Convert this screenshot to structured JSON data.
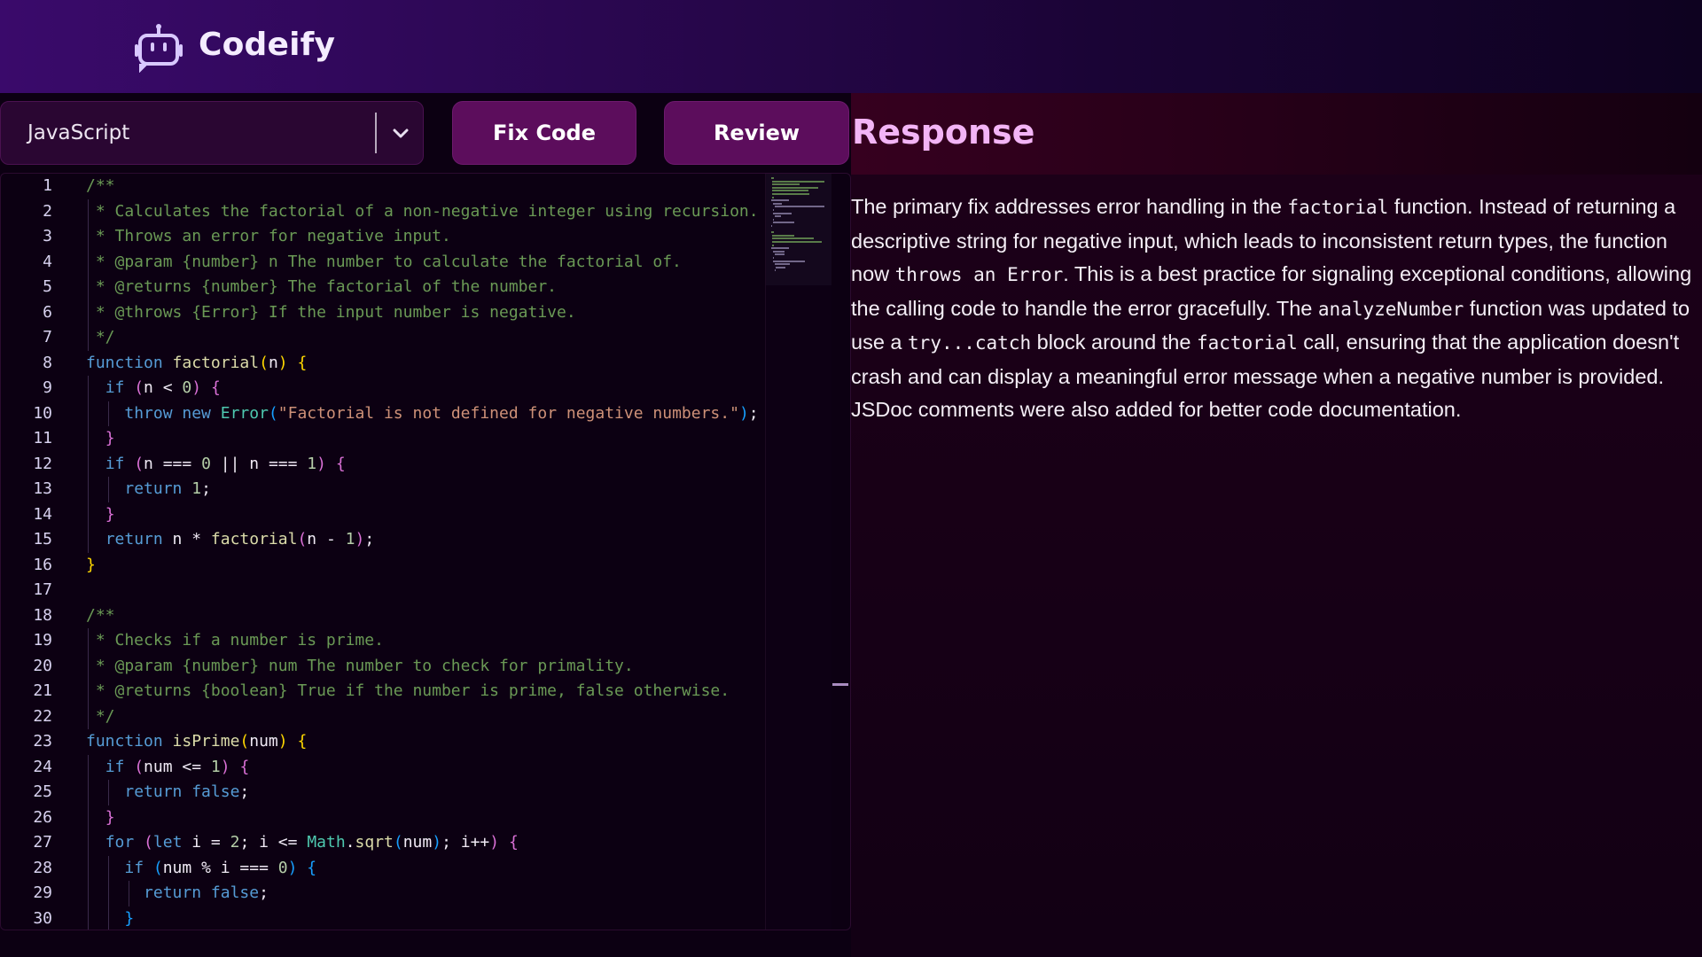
{
  "app": {
    "name": "Codeify",
    "logo_icon": "robot-icon"
  },
  "toolbar": {
    "language_value": "JavaScript",
    "fix_label": "Fix Code",
    "review_label": "Review"
  },
  "response": {
    "title": "Response",
    "seg": [
      "The primary fix addresses error handling in the ",
      "factorial",
      " function. Instead of returning a descriptive string for negative input, which leads to inconsistent return types, the function now ",
      "throws an Error",
      ". This is a best practice for signaling exceptional conditions, allowing the calling code to handle the error gracefully. The ",
      "analyzeNumber",
      " function was updated to use a ",
      "try...catch",
      " block around the ",
      "factorial",
      " call, ensuring that the application doesn't crash and can display a meaningful error message when a negative number is provided. JSDoc comments were also added for better code documentation."
    ]
  },
  "editor": {
    "line_numbers": [
      "1",
      "2",
      "3",
      "4",
      "5",
      "6",
      "7",
      "8",
      "9",
      "10",
      "11",
      "12",
      "13",
      "14",
      "15",
      "16",
      "17",
      "18",
      "19",
      "20",
      "21",
      "22",
      "23",
      "24",
      "25",
      "26",
      "27",
      "28",
      "29",
      "30"
    ],
    "lines": [
      [
        [
          "cm",
          "/**"
        ]
      ],
      [
        [
          "cm",
          " * Calculates the factorial of a non-negative integer using recursion."
        ]
      ],
      [
        [
          "cm",
          " * Throws an error for negative input."
        ]
      ],
      [
        [
          "cm",
          " * @param {number} n The number to calculate the factorial of."
        ]
      ],
      [
        [
          "cm",
          " * @returns {number} The factorial of the number."
        ]
      ],
      [
        [
          "cm",
          " * @throws {Error} If the input number is negative."
        ]
      ],
      [
        [
          "cm",
          " */"
        ]
      ],
      [
        [
          "kw",
          "function "
        ],
        [
          "fn",
          "factorial"
        ],
        [
          "p1",
          "("
        ],
        [
          "pl",
          "n"
        ],
        [
          "p1",
          ")"
        ],
        [
          "pl",
          " "
        ],
        [
          "p1",
          "{"
        ]
      ],
      [
        [
          "pl",
          "  "
        ],
        [
          "kw",
          "if "
        ],
        [
          "p2",
          "("
        ],
        [
          "pl",
          "n < "
        ],
        [
          "num",
          "0"
        ],
        [
          "p2",
          ")"
        ],
        [
          "pl",
          " "
        ],
        [
          "p2",
          "{"
        ]
      ],
      [
        [
          "pl",
          "    "
        ],
        [
          "kw",
          "throw new "
        ],
        [
          "cls",
          "Error"
        ],
        [
          "p3",
          "("
        ],
        [
          "str",
          "\"Factorial is not defined for negative numbers.\""
        ],
        [
          "p3",
          ")"
        ],
        [
          "pl",
          ";"
        ]
      ],
      [
        [
          "pl",
          "  "
        ],
        [
          "p2",
          "}"
        ]
      ],
      [
        [
          "pl",
          "  "
        ],
        [
          "kw",
          "if "
        ],
        [
          "p2",
          "("
        ],
        [
          "pl",
          "n === "
        ],
        [
          "num",
          "0"
        ],
        [
          "pl",
          " || n === "
        ],
        [
          "num",
          "1"
        ],
        [
          "p2",
          ")"
        ],
        [
          "pl",
          " "
        ],
        [
          "p2",
          "{"
        ]
      ],
      [
        [
          "pl",
          "    "
        ],
        [
          "kw",
          "return "
        ],
        [
          "num",
          "1"
        ],
        [
          "pl",
          ";"
        ]
      ],
      [
        [
          "pl",
          "  "
        ],
        [
          "p2",
          "}"
        ]
      ],
      [
        [
          "pl",
          "  "
        ],
        [
          "kw",
          "return "
        ],
        [
          "pl",
          "n * "
        ],
        [
          "fn",
          "factorial"
        ],
        [
          "p2",
          "("
        ],
        [
          "pl",
          "n - "
        ],
        [
          "num",
          "1"
        ],
        [
          "p2",
          ")"
        ],
        [
          "pl",
          ";"
        ]
      ],
      [
        [
          "p1",
          "}"
        ]
      ],
      [],
      [
        [
          "cm",
          "/**"
        ]
      ],
      [
        [
          "cm",
          " * Checks if a number is prime."
        ]
      ],
      [
        [
          "cm",
          " * @param {number} num The number to check for primality."
        ]
      ],
      [
        [
          "cm",
          " * @returns {boolean} True if the number is prime, false otherwise."
        ]
      ],
      [
        [
          "cm",
          " */"
        ]
      ],
      [
        [
          "kw",
          "function "
        ],
        [
          "fn",
          "isPrime"
        ],
        [
          "p1",
          "("
        ],
        [
          "pl",
          "num"
        ],
        [
          "p1",
          ")"
        ],
        [
          "pl",
          " "
        ],
        [
          "p1",
          "{"
        ]
      ],
      [
        [
          "pl",
          "  "
        ],
        [
          "kw",
          "if "
        ],
        [
          "p2",
          "("
        ],
        [
          "pl",
          "num <= "
        ],
        [
          "num",
          "1"
        ],
        [
          "p2",
          ")"
        ],
        [
          "pl",
          " "
        ],
        [
          "p2",
          "{"
        ]
      ],
      [
        [
          "pl",
          "    "
        ],
        [
          "kw",
          "return false"
        ],
        [
          "pl",
          ";"
        ]
      ],
      [
        [
          "pl",
          "  "
        ],
        [
          "p2",
          "}"
        ]
      ],
      [
        [
          "pl",
          "  "
        ],
        [
          "kw",
          "for "
        ],
        [
          "p2",
          "("
        ],
        [
          "kw",
          "let "
        ],
        [
          "pl",
          "i = "
        ],
        [
          "num",
          "2"
        ],
        [
          "pl",
          "; i <= "
        ],
        [
          "cls",
          "Math"
        ],
        [
          "pl",
          "."
        ],
        [
          "fn",
          "sqrt"
        ],
        [
          "p3",
          "("
        ],
        [
          "pl",
          "num"
        ],
        [
          "p3",
          ")"
        ],
        [
          "pl",
          "; i++"
        ],
        [
          "p2",
          ")"
        ],
        [
          "pl",
          " "
        ],
        [
          "p2",
          "{"
        ]
      ],
      [
        [
          "pl",
          "    "
        ],
        [
          "kw",
          "if "
        ],
        [
          "p3",
          "("
        ],
        [
          "pl",
          "num % i === "
        ],
        [
          "num",
          "0"
        ],
        [
          "p3",
          ")"
        ],
        [
          "pl",
          " "
        ],
        [
          "p3",
          "{"
        ]
      ],
      [
        [
          "pl",
          "      "
        ],
        [
          "kw",
          "return false"
        ],
        [
          "pl",
          ";"
        ]
      ],
      [
        [
          "pl",
          "    "
        ],
        [
          "p3",
          "}"
        ]
      ]
    ]
  },
  "colors": {
    "accent": "#5c0d5c",
    "title": "#f3b4f6",
    "comment": "#6a9955",
    "keyword": "#569cd6",
    "function": "#dcdcaa",
    "string": "#ce9178",
    "number": "#b5cea8",
    "class": "#4ec9b0",
    "bracket1": "#ffd700",
    "bracket2": "#da70d6",
    "bracket3": "#179fff"
  }
}
